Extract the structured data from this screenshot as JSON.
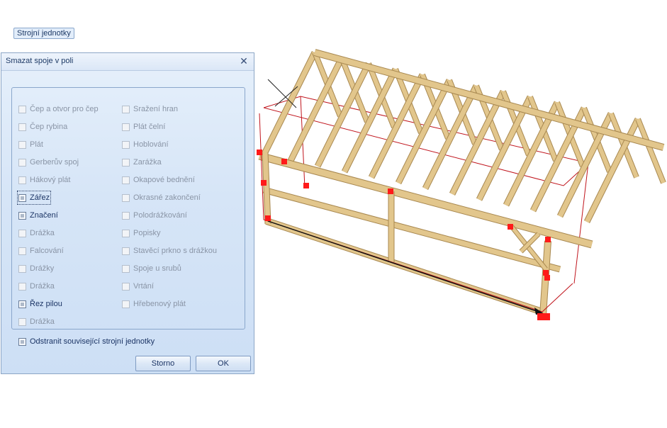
{
  "dialog": {
    "title": "Smazat spoje v poli",
    "close_glyph": "✕",
    "group_label": "Strojní jednotky",
    "left_column": [
      {
        "label": "Čep a otvor pro čep",
        "enabled": false
      },
      {
        "label": "Čep rybina",
        "enabled": false
      },
      {
        "label": "Plát",
        "enabled": false
      },
      {
        "label": "Gerberův spoj",
        "enabled": false
      },
      {
        "label": "Hákový plát",
        "enabled": false
      },
      {
        "label": "Zářez",
        "enabled": true,
        "focused": true
      },
      {
        "label": "Značení",
        "enabled": true
      },
      {
        "label": "Drážka",
        "enabled": false
      },
      {
        "label": "Falcování",
        "enabled": false
      },
      {
        "label": "Drážky",
        "enabled": false
      },
      {
        "label": "Drážka",
        "enabled": false
      },
      {
        "label": "Řez pilou",
        "enabled": true
      },
      {
        "label": "Drážka",
        "enabled": false
      }
    ],
    "right_column": [
      {
        "label": "Sražení hran",
        "enabled": false
      },
      {
        "label": "Plát čelní",
        "enabled": false
      },
      {
        "label": "Hoblování",
        "enabled": false
      },
      {
        "label": "Zarážka",
        "enabled": false
      },
      {
        "label": "Okapové bednění",
        "enabled": false
      },
      {
        "label": "Okrasné zakončení",
        "enabled": false
      },
      {
        "label": "Polodrážkování",
        "enabled": false
      },
      {
        "label": "Popisky",
        "enabled": false
      },
      {
        "label": "Stavěcí prkno s drážkou",
        "enabled": false
      },
      {
        "label": "Spoje u srubů",
        "enabled": false
      },
      {
        "label": "Vrtání",
        "enabled": false
      },
      {
        "label": "Hřebenový plát",
        "enabled": false
      }
    ],
    "remove_related_label": "Odstranit související strojní jednotky",
    "cancel_label": "Storno",
    "ok_label": "OK"
  },
  "colors": {
    "timber": "#e2c68c",
    "timber_edge": "#a88850",
    "bounding_box": "#c0141c",
    "highlight": "#ff1a1a"
  }
}
